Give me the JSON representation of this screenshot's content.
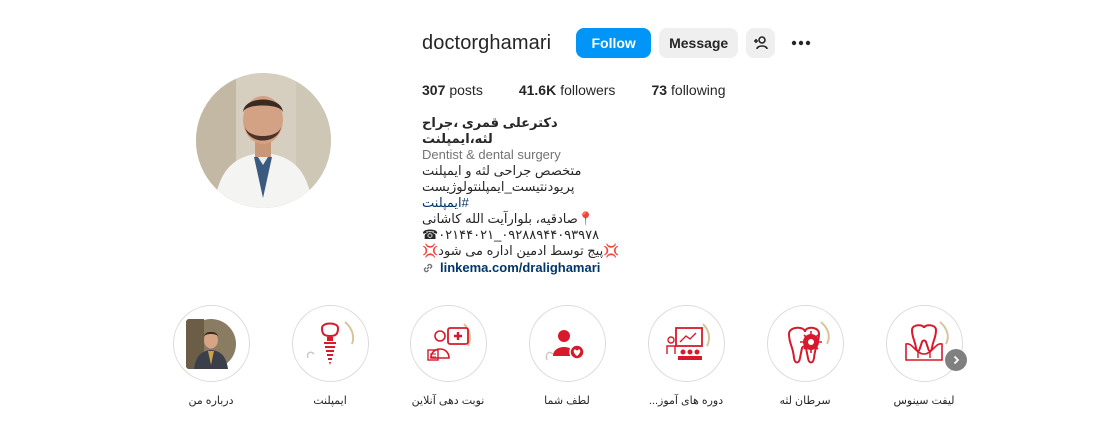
{
  "profile": {
    "username": "doctorghamari",
    "follow_label": "Follow",
    "message_label": "Message"
  },
  "stats": {
    "posts_count": "307",
    "posts_label": "posts",
    "followers_count": "41.6K",
    "followers_label": "followers",
    "following_count": "73",
    "following_label": "following"
  },
  "bio": {
    "name": "دکترعلی قمری ،جراح لثه،ایمپلنت",
    "category": "Dentist & dental surgery",
    "lines": [
      "متخصص جراحی لثه و ایمپلنت",
      "پریودنتیست_ایمپلنتولوژیست",
      "#ایمپلنت",
      "📍صادقیه، بلوارآیت الله کاشانی",
      "☎٠٢١۴۴٠٩٢٨٨٩_٠٢١۴۴٠٩٣٩٧٨",
      "💢پیج توسط ادمین اداره می شود💢"
    ],
    "link": "linkema.com/dralighamari"
  },
  "highlights": [
    {
      "label": "لیفت سینوس",
      "icon": "tooth-gum-icon"
    },
    {
      "label": "سرطان لثه",
      "icon": "tooth-virus-icon"
    },
    {
      "label": "دوره های آموز...",
      "icon": "classroom-icon"
    },
    {
      "label": "لطف شما",
      "icon": "user-heart-icon"
    },
    {
      "label": "نوبت دهی آنلاین",
      "icon": "doctor-calendar-icon"
    },
    {
      "label": "ایمپلنت",
      "icon": "implant-icon"
    },
    {
      "label": "درباره من",
      "icon": "profile-photo"
    }
  ],
  "colors": {
    "follow_blue": "#0095f6",
    "icon_red": "#d7192b",
    "link_blue": "#00376b"
  }
}
